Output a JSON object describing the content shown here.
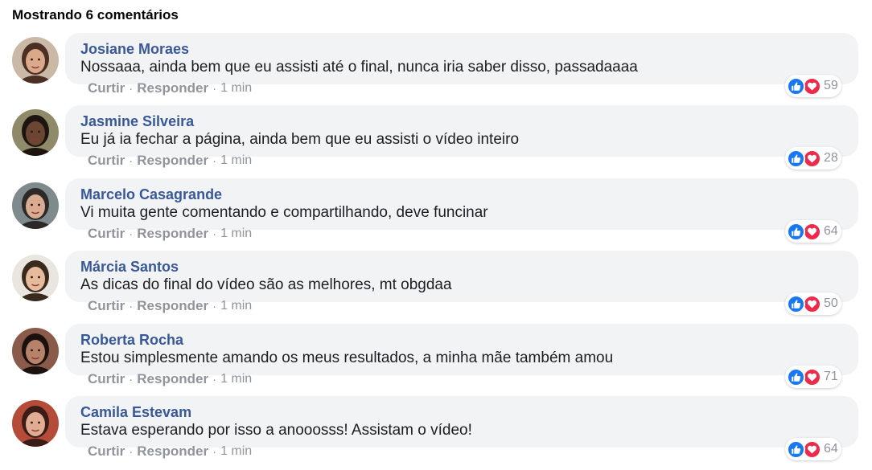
{
  "header": {
    "title": "Mostrando 6 comentários"
  },
  "colors": {
    "author": "#385898",
    "bubble": "#f2f3f5",
    "like": "#1877f2",
    "love": "#f0284a",
    "muted": "#90949c"
  },
  "icons": {
    "like": "thumbs-up-icon",
    "love": "heart-icon"
  },
  "comments": [
    {
      "author": "Josiane Moraes",
      "text": "Nossaaa, ainda bem que eu assisti até o final, nunca iria saber disso, passadaaaa",
      "like_label": "Curtir",
      "reply_label": "Responder",
      "separator": "·",
      "time": "1 min",
      "reaction_count": "59",
      "avatar": {
        "skin": "#d9a98a",
        "hair": "#4a2f22",
        "bg": "#c9b9a6"
      }
    },
    {
      "author": "Jasmine Silveira",
      "text": "Eu já ia fechar a página, ainda bem que eu assisti o vídeo inteiro",
      "like_label": "Curtir",
      "reply_label": "Responder",
      "separator": "·",
      "time": "1 min",
      "reaction_count": "28",
      "avatar": {
        "skin": "#6b4632",
        "hair": "#1e1410",
        "bg": "#8f8a6a"
      }
    },
    {
      "author": "Marcelo Casagrande",
      "text": "Vi muita gente comentando e compartilhando, deve funcinar",
      "like_label": "Curtir",
      "reply_label": "Responder",
      "separator": "·",
      "time": "1 min",
      "reaction_count": "64",
      "avatar": {
        "skin": "#d8ab92",
        "hair": "#2c2a28",
        "bg": "#7f8a8d"
      }
    },
    {
      "author": "Márcia Santos",
      "text": "As dicas do final do vídeo são as melhores, mt obgdaa",
      "like_label": "Curtir",
      "reply_label": "Responder",
      "separator": "·",
      "time": "1 min",
      "reaction_count": "50",
      "avatar": {
        "skin": "#e6bb9c",
        "hair": "#3a2a1e",
        "bg": "#e9e5df"
      }
    },
    {
      "author": "Roberta Rocha",
      "text": "Estou simplesmente amando os meus resultados, a minha mãe também amou",
      "like_label": "Curtir",
      "reply_label": "Responder",
      "separator": "·",
      "time": "1 min",
      "reaction_count": "71",
      "avatar": {
        "skin": "#b7826a",
        "hair": "#1b1210",
        "bg": "#8a5a4a"
      }
    },
    {
      "author": "Camila Estevam",
      "text": "Estava esperando por isso a anooosss! Assistam o vídeo!",
      "like_label": "Curtir",
      "reply_label": "Responder",
      "separator": "·",
      "time": "1 min",
      "reaction_count": "64",
      "avatar": {
        "skin": "#e0ad94",
        "hair": "#3b1c16",
        "bg": "#b54c3a"
      }
    }
  ]
}
